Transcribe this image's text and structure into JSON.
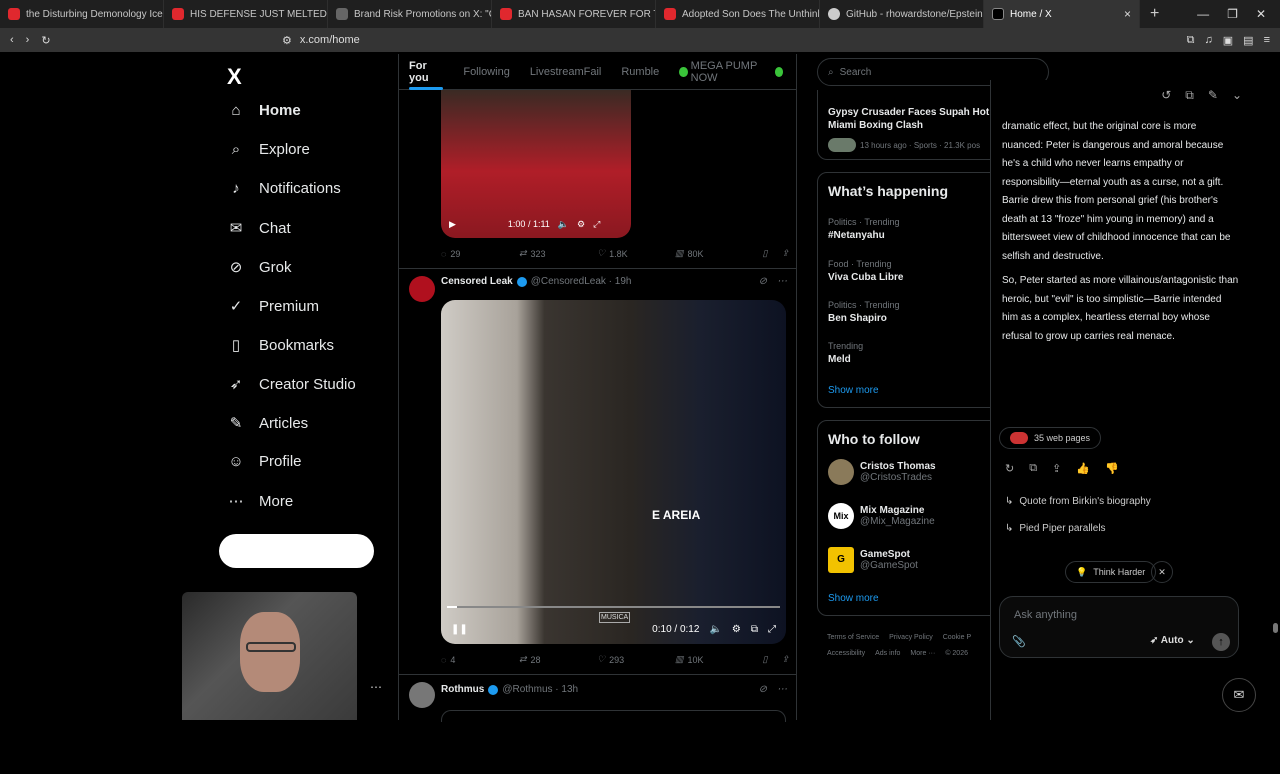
{
  "browser": {
    "tabs": [
      {
        "title": "the Disturbing Demonology Icel",
        "color": "#e0282e"
      },
      {
        "title": "HIS DEFENSE JUST MELTED DOW",
        "color": "#e0282e"
      },
      {
        "title": "Brand Risk Promotions on X: \"G",
        "color": "#888888"
      },
      {
        "title": "BAN HASAN FOREVER FOR THIS",
        "color": "#e0282e"
      },
      {
        "title": "Adopted Son Does The Unthink",
        "color": "#e0282e"
      },
      {
        "title": "GitHub - rhowardstone/Epstein-",
        "color": "#cccccc"
      },
      {
        "title": "Home / X",
        "color": "#ffffff"
      }
    ],
    "url": "x.com/home"
  },
  "nav": {
    "logo": "X",
    "items": [
      {
        "label": "Home",
        "icon": "⌂"
      },
      {
        "label": "Explore",
        "icon": "⌕"
      },
      {
        "label": "Notifications",
        "icon": "🔔"
      },
      {
        "label": "Chat",
        "icon": "✉"
      },
      {
        "label": "Grok",
        "icon": "⊘"
      },
      {
        "label": "Premium",
        "icon": "✓"
      },
      {
        "label": "Bookmarks",
        "icon": "🔖"
      },
      {
        "label": "Creator Studio",
        "icon": "🚀"
      },
      {
        "label": "Articles",
        "icon": "📝"
      },
      {
        "label": "Profile",
        "icon": "👤"
      },
      {
        "label": "More",
        "icon": "⋯"
      }
    ]
  },
  "feed": {
    "tabs": [
      "For you",
      "Following",
      "LivestreamFail",
      "Rumble",
      "MEGA PUMP NOW"
    ],
    "post1": {
      "video_time": "1:00 / 1:11",
      "replies": "29",
      "reposts": "323",
      "likes": "1.8K",
      "views": "80K"
    },
    "post2": {
      "name": "Censored Leak",
      "handle": "@CensoredLeak · 19h",
      "overlay": "E AREIA",
      "watermark": "MUSICA",
      "video_time": "0:10 / 0:12",
      "replies": "4",
      "reposts": "28",
      "likes": "293",
      "views": "10K"
    },
    "post3": {
      "name": "Rothmus",
      "handle": "@Rothmus · 13h"
    }
  },
  "right": {
    "search_placeholder": "Search",
    "top_story": {
      "title": "Gypsy Crusader Faces Supah Hot Fire in Miami Boxing Clash",
      "meta": "13 hours ago · Sports · 21.3K pos"
    },
    "happening_title": "What’s happening",
    "trends": [
      {
        "meta": "Politics · Trending",
        "name": "#Netanyahu"
      },
      {
        "meta": "Food · Trending",
        "name": "Viva Cuba Libre"
      },
      {
        "meta": "Politics · Trending",
        "name": "Ben Shapiro"
      },
      {
        "meta": "Trending",
        "name": "Meld"
      }
    ],
    "show_more": "Show more",
    "follow_title": "Who to follow",
    "follows": [
      {
        "name": "Cristos Thomas",
        "handle": "@CristosTrades"
      },
      {
        "name": "Mix Magazine",
        "handle": "@Mix_Magazine"
      },
      {
        "name": "GameSpot",
        "handle": "@GameSpot"
      }
    ],
    "footer": [
      "Terms of Service",
      "Privacy Policy",
      "Cookie P",
      "Accessibility",
      "Ads info",
      "More ···",
      "© 2026"
    ]
  },
  "grok": {
    "p1": "dramatic effect, but the original core is more nuanced: Peter is dangerous and amoral because he's a child who never learns empathy or responsibility—eternal youth as a curse, not a gift. Barrie drew this from personal grief (his brother's death at 13 \"froze\" him young in memory) and a bittersweet view of childhood innocence that can be selfish and destructive.",
    "p2": "So, Peter started as more villainous/antagonistic than heroic, but \"evil\" is too simplistic—Barrie intended him as a complex, heartless eternal boy whose refusal to grow up carries real menace.",
    "sources": "35 web pages",
    "suggestions": [
      "Quote from Birkin's biography",
      "Pied Piper parallels"
    ],
    "think_harder": "Think Harder",
    "ask_placeholder": "Ask anything",
    "mode": "Auto"
  }
}
